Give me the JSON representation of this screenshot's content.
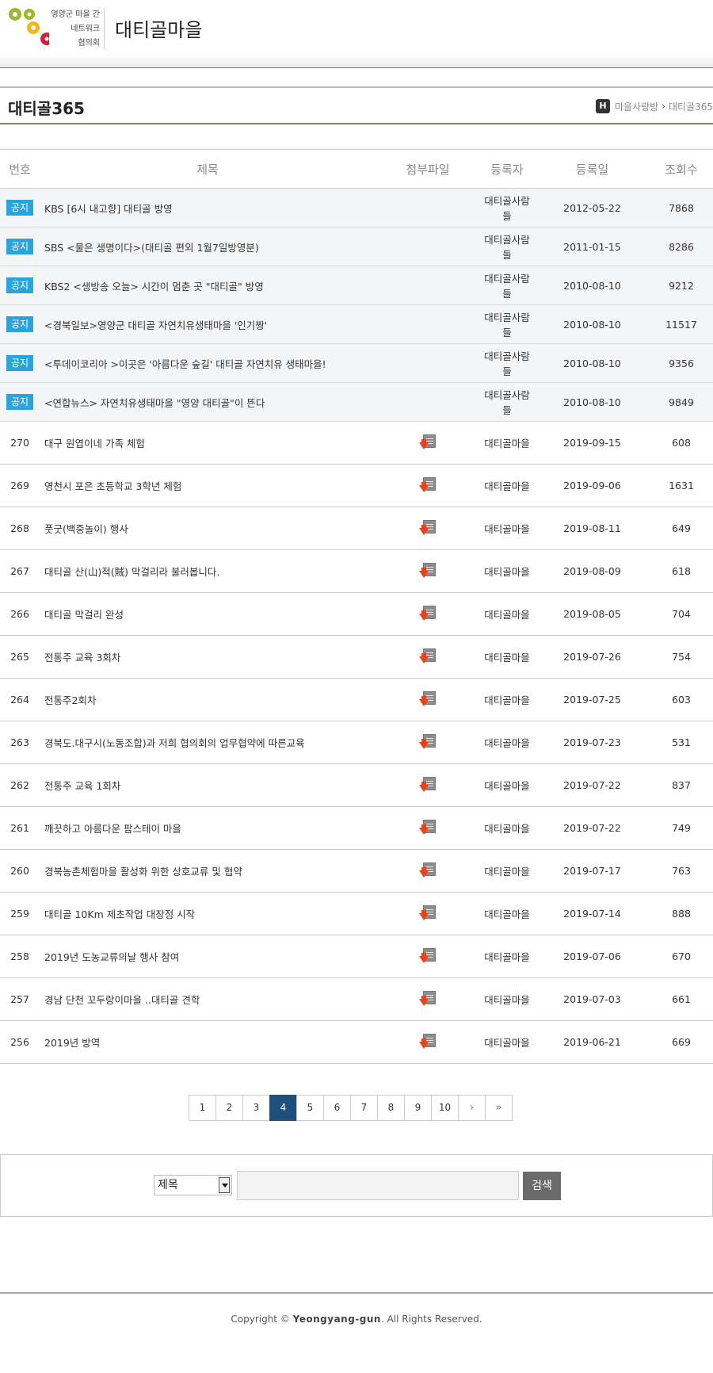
{
  "header": {
    "logo_lines": [
      "영양군 마을 간",
      "네트워크",
      "협의회"
    ],
    "logo_alt": "OKOK",
    "site_title": "대티골마을"
  },
  "page": {
    "title": "대티골365",
    "breadcrumb": [
      "마을사랑방",
      "대티골365"
    ]
  },
  "table": {
    "columns": [
      "번호",
      "제목",
      "첨부파일",
      "등록자",
      "등록일",
      "조회수"
    ],
    "notice_label": "공지",
    "notices": [
      {
        "title": "KBS [6시 내고향] 대티골 방영",
        "author": "대티골사람들",
        "date": "2012-05-22",
        "views": "7868"
      },
      {
        "title": "SBS <물은 생명이다>(대티골 편외 1월7일방영분)",
        "author": "대티골사람들",
        "date": "2011-01-15",
        "views": "8286"
      },
      {
        "title": "KBS2 <생방송 오늘> 시간이 멈춘 곳 \"대티골\" 방영",
        "author": "대티골사람들",
        "date": "2010-08-10",
        "views": "9212"
      },
      {
        "title": "<경북일보>영양군 대티골 자연치유생태마을 '인기짱'",
        "author": "대티골사람들",
        "date": "2010-08-10",
        "views": "11517"
      },
      {
        "title": "<투데이코리아 >이곳은 '아름다운 숲길' 대티골 자연치유 생태마을!",
        "author": "대티골사람들",
        "date": "2010-08-10",
        "views": "9356"
      },
      {
        "title": "<연합뉴스> 자연치유생태마을 \"영양 대티골\"이 뜬다",
        "author": "대티골사람들",
        "date": "2010-08-10",
        "views": "9849"
      }
    ],
    "posts": [
      {
        "num": "270",
        "title": "대구 원엽이네 가족 체험",
        "author": "대티골마을",
        "date": "2019-09-15",
        "views": "608"
      },
      {
        "num": "269",
        "title": "영천시 포은 초등학교 3학년 체험",
        "author": "대티골마을",
        "date": "2019-09-06",
        "views": "1631"
      },
      {
        "num": "268",
        "title": "풋굿(백중놀이) 행사",
        "author": "대티골마을",
        "date": "2019-08-11",
        "views": "649"
      },
      {
        "num": "267",
        "title": "대티골 산(山)적(賊) 막걸리라 불러봅니다.",
        "author": "대티골마을",
        "date": "2019-08-09",
        "views": "618"
      },
      {
        "num": "266",
        "title": "대티골 막걸리 완성",
        "author": "대티골마을",
        "date": "2019-08-05",
        "views": "704"
      },
      {
        "num": "265",
        "title": "전통주 교육 3회차",
        "author": "대티골마을",
        "date": "2019-07-26",
        "views": "754"
      },
      {
        "num": "264",
        "title": "전통주2회차",
        "author": "대티골마을",
        "date": "2019-07-25",
        "views": "603"
      },
      {
        "num": "263",
        "title": "경북도.대구시(노동조합)과 저희 협의회의 업무협약에 따른교육",
        "author": "대티골마을",
        "date": "2019-07-23",
        "views": "531"
      },
      {
        "num": "262",
        "title": "전통주 교육 1회차",
        "author": "대티골마을",
        "date": "2019-07-22",
        "views": "837"
      },
      {
        "num": "261",
        "title": "깨끗하고 아름다운 팜스테이 마을",
        "author": "대티골마을",
        "date": "2019-07-22",
        "views": "749"
      },
      {
        "num": "260",
        "title": "경북농촌체험마을 활성화 위한 상호교류 및 협약",
        "author": "대티골마을",
        "date": "2019-07-17",
        "views": "763"
      },
      {
        "num": "259",
        "title": "대티골 10Km 제초작업 대장정 시작",
        "author": "대티골마을",
        "date": "2019-07-14",
        "views": "888"
      },
      {
        "num": "258",
        "title": "2019년 도농교류의날 행사 참여",
        "author": "대티골마을",
        "date": "2019-07-06",
        "views": "670"
      },
      {
        "num": "257",
        "title": "경남 단천 꼬두랑이마을 ..대티골 견학",
        "author": "대티골마을",
        "date": "2019-07-03",
        "views": "661"
      },
      {
        "num": "256",
        "title": "2019년 방역",
        "author": "대티골마을",
        "date": "2019-06-21",
        "views": "669"
      }
    ]
  },
  "pagination": {
    "pages": [
      "1",
      "2",
      "3",
      "4",
      "5",
      "6",
      "7",
      "8",
      "9",
      "10"
    ],
    "current": "4",
    "next": "›",
    "last": "»"
  },
  "search": {
    "select_value": "제목",
    "input_value": "",
    "button_label": "검색"
  },
  "footer": {
    "copyright_prefix": "Copyright © ",
    "owner": "Yeongyang-gun",
    "copyright_suffix": ". All Rights Reserved."
  },
  "colors": {
    "notice_badge": "#29a4dc",
    "pager_current": "#1e4e7c",
    "file_arrow": "#e6431b",
    "search_button": "#6b6b6b"
  }
}
